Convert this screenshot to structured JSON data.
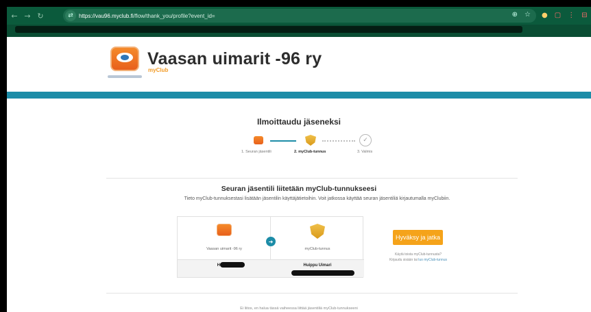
{
  "browser": {
    "nav": {
      "back": "←",
      "forward": "→",
      "reload": "↻"
    },
    "site_info_icon": "⇄",
    "url_domain": "https://vau96.myclub.fi",
    "url_path": "/flow/thank_you/profile?event_id=",
    "zoom_icon": "⊕",
    "star_icon": "☆",
    "extensions": [
      "●",
      "▢",
      "⋮",
      "⊟",
      "▣"
    ]
  },
  "header": {
    "club_name": "Vaasan uimarit -96 ry",
    "club_sub": "myClub"
  },
  "flow": {
    "title": "Ilmoittaudu jäseneksi",
    "steps": [
      {
        "label": "1. Seuran jäsentili"
      },
      {
        "label": "2. myClub-tunnus"
      },
      {
        "label": "3. Valmis"
      }
    ],
    "done_icon": "✓"
  },
  "link": {
    "title": "Seuran jäsentili liitetään myClub-tunnukseesi",
    "description": "Tieto myClub-tunnuksestasi lisätään jäsentilin käyttäjätietoihin. Voit jatkossa käyttää seuran jäsentiliä kirjautumalla myClubiin.",
    "left_name": "Vaasan uimarit -96 ry",
    "left_user": "Huippu",
    "right_name": "myClub-tunnus",
    "right_user": "Huippu Uimari",
    "arrow": "➜"
  },
  "actions": {
    "accept_label": "Hyväksy ja jatka",
    "hint_line1": "Käytä toista myClub-tunnusta?",
    "hint_line2_prefix": "Kirjaudu sisään tai ",
    "hint_line2_link": "luo myClub-tunnus"
  },
  "footer_note": "Ei liitos, en halua tässä vaiheessa liittää jäsentiliä myClub-tunnukseeni"
}
